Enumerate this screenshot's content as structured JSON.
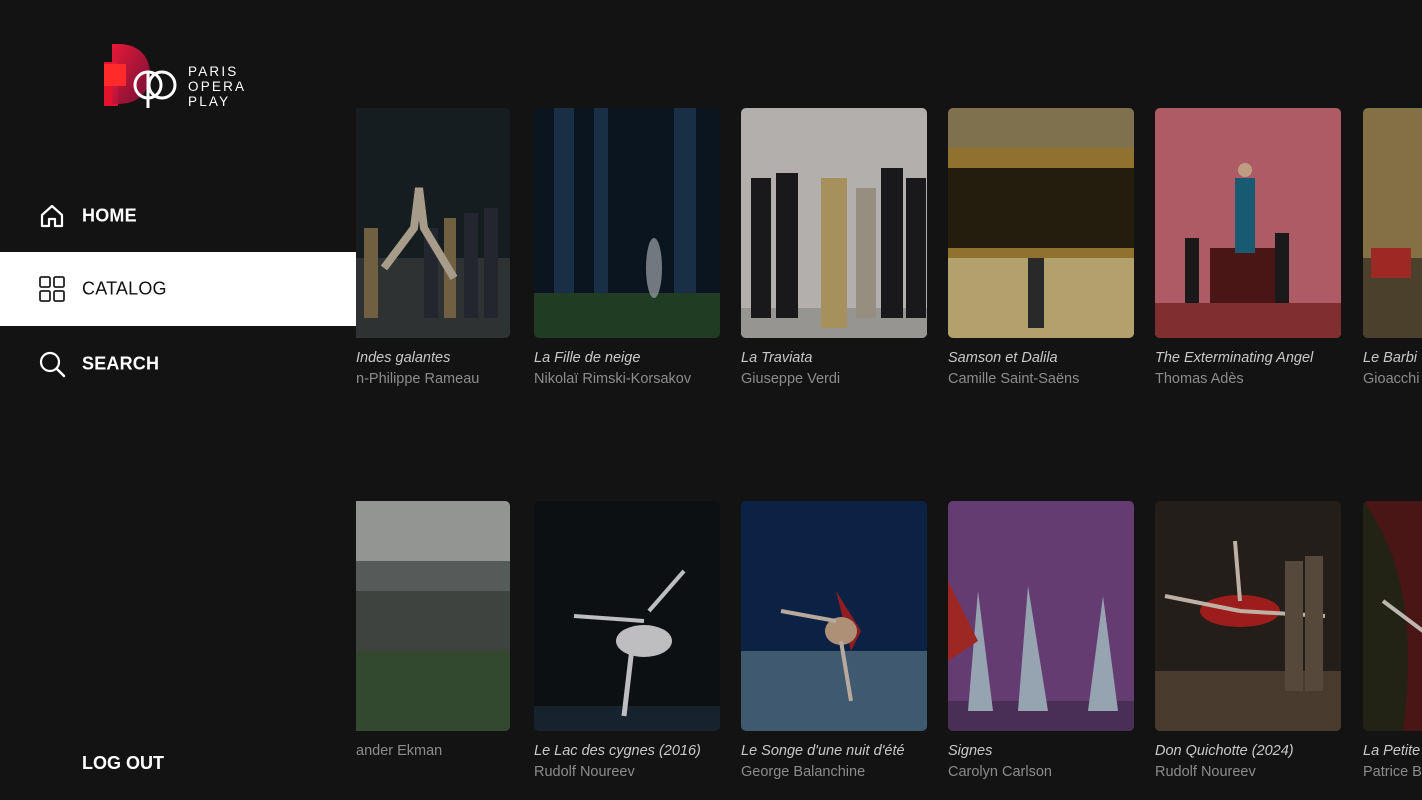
{
  "brand": {
    "line1": "PARIS",
    "line2": "OPERA",
    "line3": "PLAY"
  },
  "nav": {
    "home": "HOME",
    "catalog": "CATALOG",
    "search": "SEARCH",
    "logout": "LOG OUT",
    "active": "catalog"
  },
  "rows": [
    {
      "items": [
        {
          "title": "Les Indes galantes",
          "subtitle": "Jean-Philippe Rameau",
          "visible_title": "Indes galantes",
          "visible_subtitle": "n-Philippe Rameau"
        },
        {
          "title": "La Fille de neige",
          "subtitle": "Nikolaï Rimski-Korsakov"
        },
        {
          "title": "La Traviata",
          "subtitle": "Giuseppe Verdi"
        },
        {
          "title": "Samson et Dalila",
          "subtitle": "Camille Saint-Saëns"
        },
        {
          "title": "The Exterminating Angel",
          "subtitle": "Thomas Adès"
        },
        {
          "title": "Le Barbi",
          "subtitle": "Gioacchi"
        }
      ]
    },
    {
      "items": [
        {
          "title": "",
          "subtitle": "ander Ekman"
        },
        {
          "title": "Le Lac des cygnes (2016)",
          "subtitle": "Rudolf Noureev"
        },
        {
          "title": "Le Songe d'une nuit d'été",
          "subtitle": "George Balanchine"
        },
        {
          "title": "Signes",
          "subtitle": "Carolyn Carlson"
        },
        {
          "title": "Don Quichotte (2024)",
          "subtitle": "Rudolf Noureev"
        },
        {
          "title": "La Petite",
          "subtitle": "Patrice B"
        }
      ]
    }
  ],
  "colors": {
    "background": "#131313",
    "active_nav_bg": "#ffffff",
    "brand_red": "#e3122d"
  }
}
